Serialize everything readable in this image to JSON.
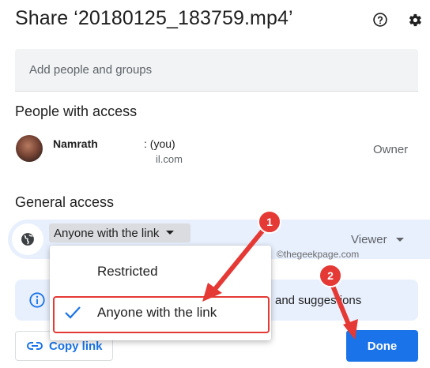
{
  "dialog": {
    "title": "Share ‘20180125_183759.mp4’",
    "help_icon": "help-circle-icon",
    "settings_icon": "gear-icon"
  },
  "add_people": {
    "placeholder": "Add people and groups"
  },
  "people_with_access": {
    "heading": "People with access",
    "person": {
      "name": "Namrath",
      "suffix": ": (you)",
      "email": "il.com",
      "role": "Owner"
    }
  },
  "general_access": {
    "heading": "General access",
    "selected": "Anyone with the link",
    "role": "Viewer",
    "globe_icon": "globe-icon"
  },
  "dropdown": {
    "options": [
      {
        "label": "Restricted",
        "checked": false
      },
      {
        "label": "Anyone with the link",
        "checked": true
      }
    ]
  },
  "info_banner": {
    "text": "and suggestions"
  },
  "watermark": "©thegeekpage.com",
  "footer": {
    "copy_link": "Copy link",
    "done": "Done"
  },
  "annotations": {
    "badge_1": "1",
    "badge_2": "2",
    "color": "#e53935"
  }
}
